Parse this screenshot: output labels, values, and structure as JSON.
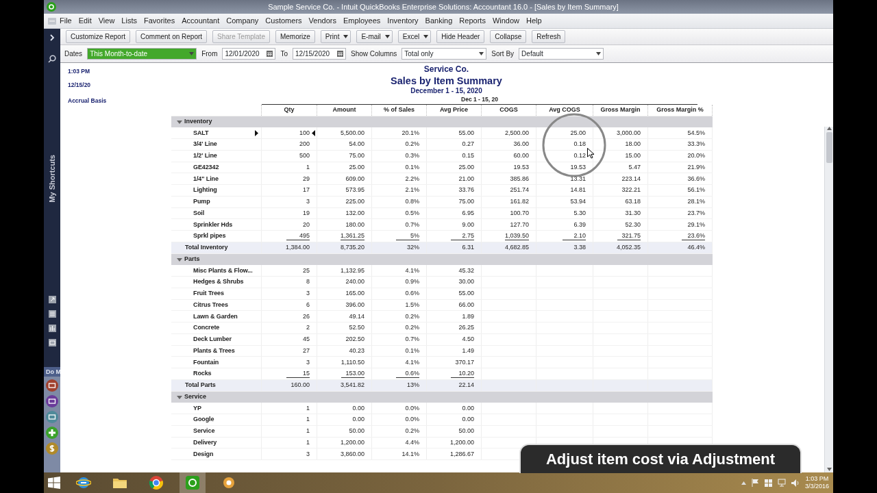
{
  "window": {
    "title": "Sample Service Co.  - Intuit QuickBooks Enterprise Solutions: Accountant 16.0 - [Sales by Item Summary]"
  },
  "menu": [
    "File",
    "Edit",
    "View",
    "Lists",
    "Favorites",
    "Accountant",
    "Company",
    "Customers",
    "Vendors",
    "Employees",
    "Inventory",
    "Banking",
    "Reports",
    "Window",
    "Help"
  ],
  "toolbar": [
    {
      "label": "Customize Report",
      "kind": "button",
      "disabled": false
    },
    {
      "label": "Comment on Report",
      "kind": "button",
      "disabled": false
    },
    {
      "label": "Share Template",
      "kind": "button",
      "disabled": true
    },
    {
      "label": "Memorize",
      "kind": "button",
      "disabled": false
    },
    {
      "label": "Print",
      "kind": "dropdown",
      "disabled": false
    },
    {
      "label": "E-mail",
      "kind": "dropdown",
      "disabled": false
    },
    {
      "label": "Excel",
      "kind": "dropdown",
      "disabled": false
    },
    {
      "label": "Hide Header",
      "kind": "button",
      "disabled": false
    },
    {
      "label": "Collapse",
      "kind": "button",
      "disabled": false
    },
    {
      "label": "Refresh",
      "kind": "button",
      "disabled": false
    }
  ],
  "filters": [
    {
      "kind": "label",
      "text": "Dates"
    },
    {
      "kind": "select",
      "value": "This Month-to-date",
      "highlighted": true
    },
    {
      "kind": "label",
      "text": "From"
    },
    {
      "kind": "date",
      "value": "12/01/2020"
    },
    {
      "kind": "label",
      "text": "To"
    },
    {
      "kind": "date",
      "value": "12/15/2020"
    },
    {
      "kind": "label",
      "text": "Show Columns"
    },
    {
      "kind": "select",
      "value": "Total only",
      "highlighted": false
    },
    {
      "kind": "label",
      "text": "Sort By"
    },
    {
      "kind": "select",
      "value": "Default",
      "highlighted": false
    }
  ],
  "sidebar": {
    "title": "My Shortcuts",
    "section": "Do M"
  },
  "report": {
    "time": "1:03 PM",
    "date": "12/15/20",
    "basis": "Accrual Basis",
    "company": "Service Co.",
    "title": "Sales by Item Summary",
    "period": "December 1 - 15, 2020",
    "column_group": "Dec 1 - 15, 20",
    "columns": [
      "Qty",
      "Amount",
      "% of Sales",
      "Avg Price",
      "COGS",
      "Avg COGS",
      "Gross Margin",
      "Gross Margin %"
    ],
    "groups": [
      {
        "name": "Inventory",
        "expanded": true,
        "rows": [
          {
            "name": "SALT",
            "selected": true,
            "values": [
              "100",
              "5,500.00",
              "20.1%",
              "55.00",
              "2,500.00",
              "25.00",
              "3,000.00",
              "54.5%"
            ]
          },
          {
            "name": "3/4' Line",
            "selected": false,
            "values": [
              "200",
              "54.00",
              "0.2%",
              "0.27",
              "36.00",
              "0.18",
              "18.00",
              "33.3%"
            ]
          },
          {
            "name": "1/2' Line",
            "selected": false,
            "values": [
              "500",
              "75.00",
              "0.3%",
              "0.15",
              "60.00",
              "0.12",
              "15.00",
              "20.0%"
            ]
          },
          {
            "name": "GE42342",
            "selected": false,
            "values": [
              "1",
              "25.00",
              "0.1%",
              "25.00",
              "19.53",
              "19.53",
              "5.47",
              "21.9%"
            ]
          },
          {
            "name": "1/4\" Line",
            "selected": false,
            "values": [
              "29",
              "609.00",
              "2.2%",
              "21.00",
              "385.86",
              "13.31",
              "223.14",
              "36.6%"
            ]
          },
          {
            "name": "Lighting",
            "selected": false,
            "values": [
              "17",
              "573.95",
              "2.1%",
              "33.76",
              "251.74",
              "14.81",
              "322.21",
              "56.1%"
            ]
          },
          {
            "name": "Pump",
            "selected": false,
            "values": [
              "3",
              "225.00",
              "0.8%",
              "75.00",
              "161.82",
              "53.94",
              "63.18",
              "28.1%"
            ]
          },
          {
            "name": "Soil",
            "selected": false,
            "values": [
              "19",
              "132.00",
              "0.5%",
              "6.95",
              "100.70",
              "5.30",
              "31.30",
              "23.7%"
            ]
          },
          {
            "name": "Sprinkler Hds",
            "selected": false,
            "values": [
              "20",
              "180.00",
              "0.7%",
              "9.00",
              "127.70",
              "6.39",
              "52.30",
              "29.1%"
            ]
          },
          {
            "name": "Sprkl pipes",
            "selected": false,
            "values": [
              "495",
              "1,361.25",
              "5%",
              "2.75",
              "1,039.50",
              "2.10",
              "321.75",
              "23.6%"
            ]
          }
        ],
        "total": {
          "name": "Total Inventory",
          "values": [
            "1,384.00",
            "8,735.20",
            "32%",
            "6.31",
            "4,682.85",
            "3.38",
            "4,052.35",
            "46.4%"
          ]
        }
      },
      {
        "name": "Parts",
        "expanded": true,
        "rows": [
          {
            "name": "Misc Plants & Flow...",
            "selected": false,
            "values": [
              "25",
              "1,132.95",
              "4.1%",
              "45.32"
            ]
          },
          {
            "name": "Hedges & Shrubs",
            "selected": false,
            "values": [
              "8",
              "240.00",
              "0.9%",
              "30.00"
            ]
          },
          {
            "name": "Fruit Trees",
            "selected": false,
            "values": [
              "3",
              "165.00",
              "0.6%",
              "55.00"
            ]
          },
          {
            "name": "Citrus Trees",
            "selected": false,
            "values": [
              "6",
              "396.00",
              "1.5%",
              "66.00"
            ]
          },
          {
            "name": "Lawn & Garden",
            "selected": false,
            "values": [
              "26",
              "49.14",
              "0.2%",
              "1.89"
            ]
          },
          {
            "name": "Concrete",
            "selected": false,
            "values": [
              "2",
              "52.50",
              "0.2%",
              "26.25"
            ]
          },
          {
            "name": "Deck Lumber",
            "selected": false,
            "values": [
              "45",
              "202.50",
              "0.7%",
              "4.50"
            ]
          },
          {
            "name": "Plants & Trees",
            "selected": false,
            "values": [
              "27",
              "40.23",
              "0.1%",
              "1.49"
            ]
          },
          {
            "name": "Fountain",
            "selected": false,
            "values": [
              "3",
              "1,110.50",
              "4.1%",
              "370.17"
            ]
          },
          {
            "name": "Rocks",
            "selected": false,
            "values": [
              "15",
              "153.00",
              "0.6%",
              "10.20"
            ]
          }
        ],
        "total": {
          "name": "Total Parts",
          "values": [
            "160.00",
            "3,541.82",
            "13%",
            "22.14"
          ]
        }
      },
      {
        "name": "Service",
        "expanded": true,
        "rows": [
          {
            "name": "YP",
            "selected": false,
            "values": [
              "1",
              "0.00",
              "0.0%",
              "0.00"
            ]
          },
          {
            "name": "Google",
            "selected": false,
            "values": [
              "1",
              "0.00",
              "0.0%",
              "0.00"
            ]
          },
          {
            "name": "Service",
            "selected": false,
            "values": [
              "1",
              "50.00",
              "0.2%",
              "50.00"
            ]
          },
          {
            "name": "Delivery",
            "selected": false,
            "values": [
              "1",
              "1,200.00",
              "4.4%",
              "1,200.00"
            ]
          },
          {
            "name": "Design",
            "selected": false,
            "values": [
              "3",
              "3,860.00",
              "14.1%",
              "1,286.67"
            ]
          }
        ]
      }
    ]
  },
  "caption": "Adjust item cost via Adjustment",
  "taskbar": {
    "time": "1:03 PM",
    "date": "3/3/2016"
  }
}
